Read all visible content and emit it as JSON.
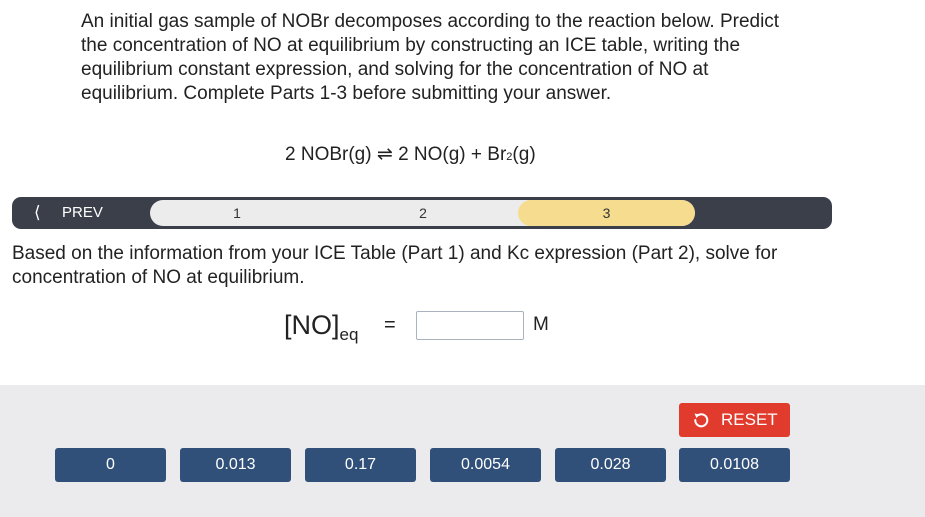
{
  "intro": {
    "text": "An initial gas sample of NOBr decomposes according to the reaction below. Predict the concentration of NO at equilibrium by constructing an ICE table, writing the equilibrium constant expression, and solving for the concentration of NO at equilibrium. Complete Parts 1-3 before submitting your answer."
  },
  "reaction": {
    "left": "2 NOBr(g)",
    "arrow": "⇌",
    "right_a": "2 NO(g) + Br",
    "right_sub": "2",
    "right_b": "(g)"
  },
  "nav": {
    "prev_label": "PREV",
    "steps": [
      "1",
      "2",
      "3"
    ],
    "active_step": "3"
  },
  "question": {
    "text": "Based on the information from your ICE Table (Part 1) and Kc expression (Part 2), solve for concentration of NO at equilibrium."
  },
  "answer": {
    "label_main": "[NO]",
    "label_sub": "eq",
    "equals": "=",
    "value": "",
    "unit": "M"
  },
  "tray": {
    "reset_label": "RESET",
    "options": [
      "0",
      "0.013",
      "0.17",
      "0.0054",
      "0.028",
      "0.0108"
    ]
  },
  "colors": {
    "nav_bar": "#3a3f4a",
    "active_step": "#f5dc8e",
    "reset": "#e03b2d",
    "tile": "#30507a",
    "tray_bg": "#ebebed"
  }
}
